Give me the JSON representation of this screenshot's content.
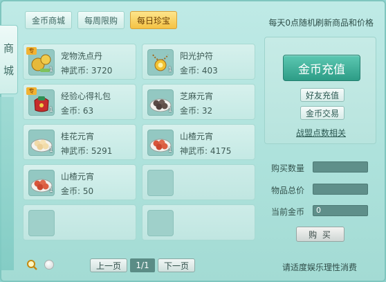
{
  "sidebar": {
    "title_chars": [
      "商",
      "城"
    ]
  },
  "tabs": [
    {
      "label": "金币商城",
      "active": false
    },
    {
      "label": "每周限购",
      "active": false
    },
    {
      "label": "每日珍宝",
      "active": true
    }
  ],
  "notice": "每天0点随机刷新商品和价格",
  "items": [
    {
      "name": "宠物洗点丹",
      "price": "神武币: 3720",
      "qty": "1",
      "tag": "专",
      "icon": "gourd-icon"
    },
    {
      "name": "阳光护符",
      "price": "金币: 403",
      "qty": "1",
      "tag": "",
      "icon": "amulet-icon"
    },
    {
      "name": "经验心得礼包",
      "price": "金币: 63",
      "qty": "1",
      "tag": "专",
      "icon": "gift-bag-icon"
    },
    {
      "name": "芝麻元宵",
      "price": "金币: 32",
      "qty": "1",
      "tag": "",
      "icon": "dumpling-icon"
    },
    {
      "name": "桂花元宵",
      "price": "神武币: 5291",
      "qty": "1",
      "tag": "",
      "icon": "dumpling-icon"
    },
    {
      "name": "山楂元宵",
      "price": "神武币: 4175",
      "qty": "1",
      "tag": "",
      "icon": "dumpling-icon"
    },
    {
      "name": "山楂元宵",
      "price": "金币: 50",
      "qty": "1",
      "tag": "",
      "icon": "dumpling-icon"
    }
  ],
  "right": {
    "recharge_label": "金币充值",
    "friend_recharge": "好友充值",
    "gold_trade": "金币交易",
    "guild_link": "战盟点数相关",
    "buy_qty_label": "购买数量",
    "total_label": "物品总价",
    "current_gold_label": "当前金币",
    "current_gold_value": "0",
    "buy_label": "购 买"
  },
  "pager": {
    "prev": "上一页",
    "page": "1/1",
    "next": "下一页"
  },
  "footer": "请适度娱乐理性消费"
}
